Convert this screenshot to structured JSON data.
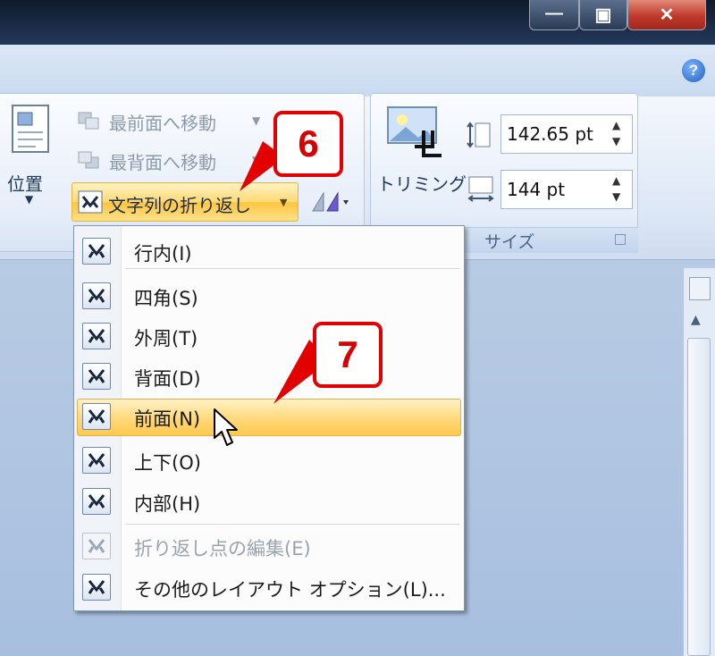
{
  "window": {
    "minimize_label": "—",
    "restore_label": "▣",
    "close_label": "✕"
  },
  "ribbon": {
    "help_label": "?",
    "position_label": "位置",
    "bring_front_label": "最前面へ移動",
    "send_back_label": "最背面へ移動",
    "wrap_text_label": "文字列の折り返し",
    "trimming_label": "トリミング",
    "height_value": "142.65 pt",
    "width_value": "144 pt",
    "size_group_label": "サイズ"
  },
  "menu": {
    "items": [
      {
        "label": "行内(I)",
        "icon": "wrap-inline-icon",
        "enabled": true
      },
      {
        "label": "四角(S)",
        "icon": "wrap-square-icon",
        "enabled": true
      },
      {
        "label": "外周(T)",
        "icon": "wrap-tight-icon",
        "enabled": true
      },
      {
        "label": "背面(D)",
        "icon": "wrap-behind-icon",
        "enabled": true
      },
      {
        "label": "前面(N)",
        "icon": "wrap-front-icon",
        "enabled": true,
        "highlighted": true
      },
      {
        "label": "上下(O)",
        "icon": "wrap-topbottom-icon",
        "enabled": true
      },
      {
        "label": "内部(H)",
        "icon": "wrap-through-icon",
        "enabled": true
      },
      {
        "label": "折り返し点の編集(E)",
        "icon": "edit-wrap-points-icon",
        "enabled": false
      },
      {
        "label": "その他のレイアウト オプション(L)...",
        "icon": "layout-options-icon",
        "enabled": true
      }
    ]
  },
  "callouts": {
    "step6": "6",
    "step7": "7"
  },
  "colors": {
    "accent_highlight": "#ffd87a",
    "callout_red": "#e30000"
  }
}
